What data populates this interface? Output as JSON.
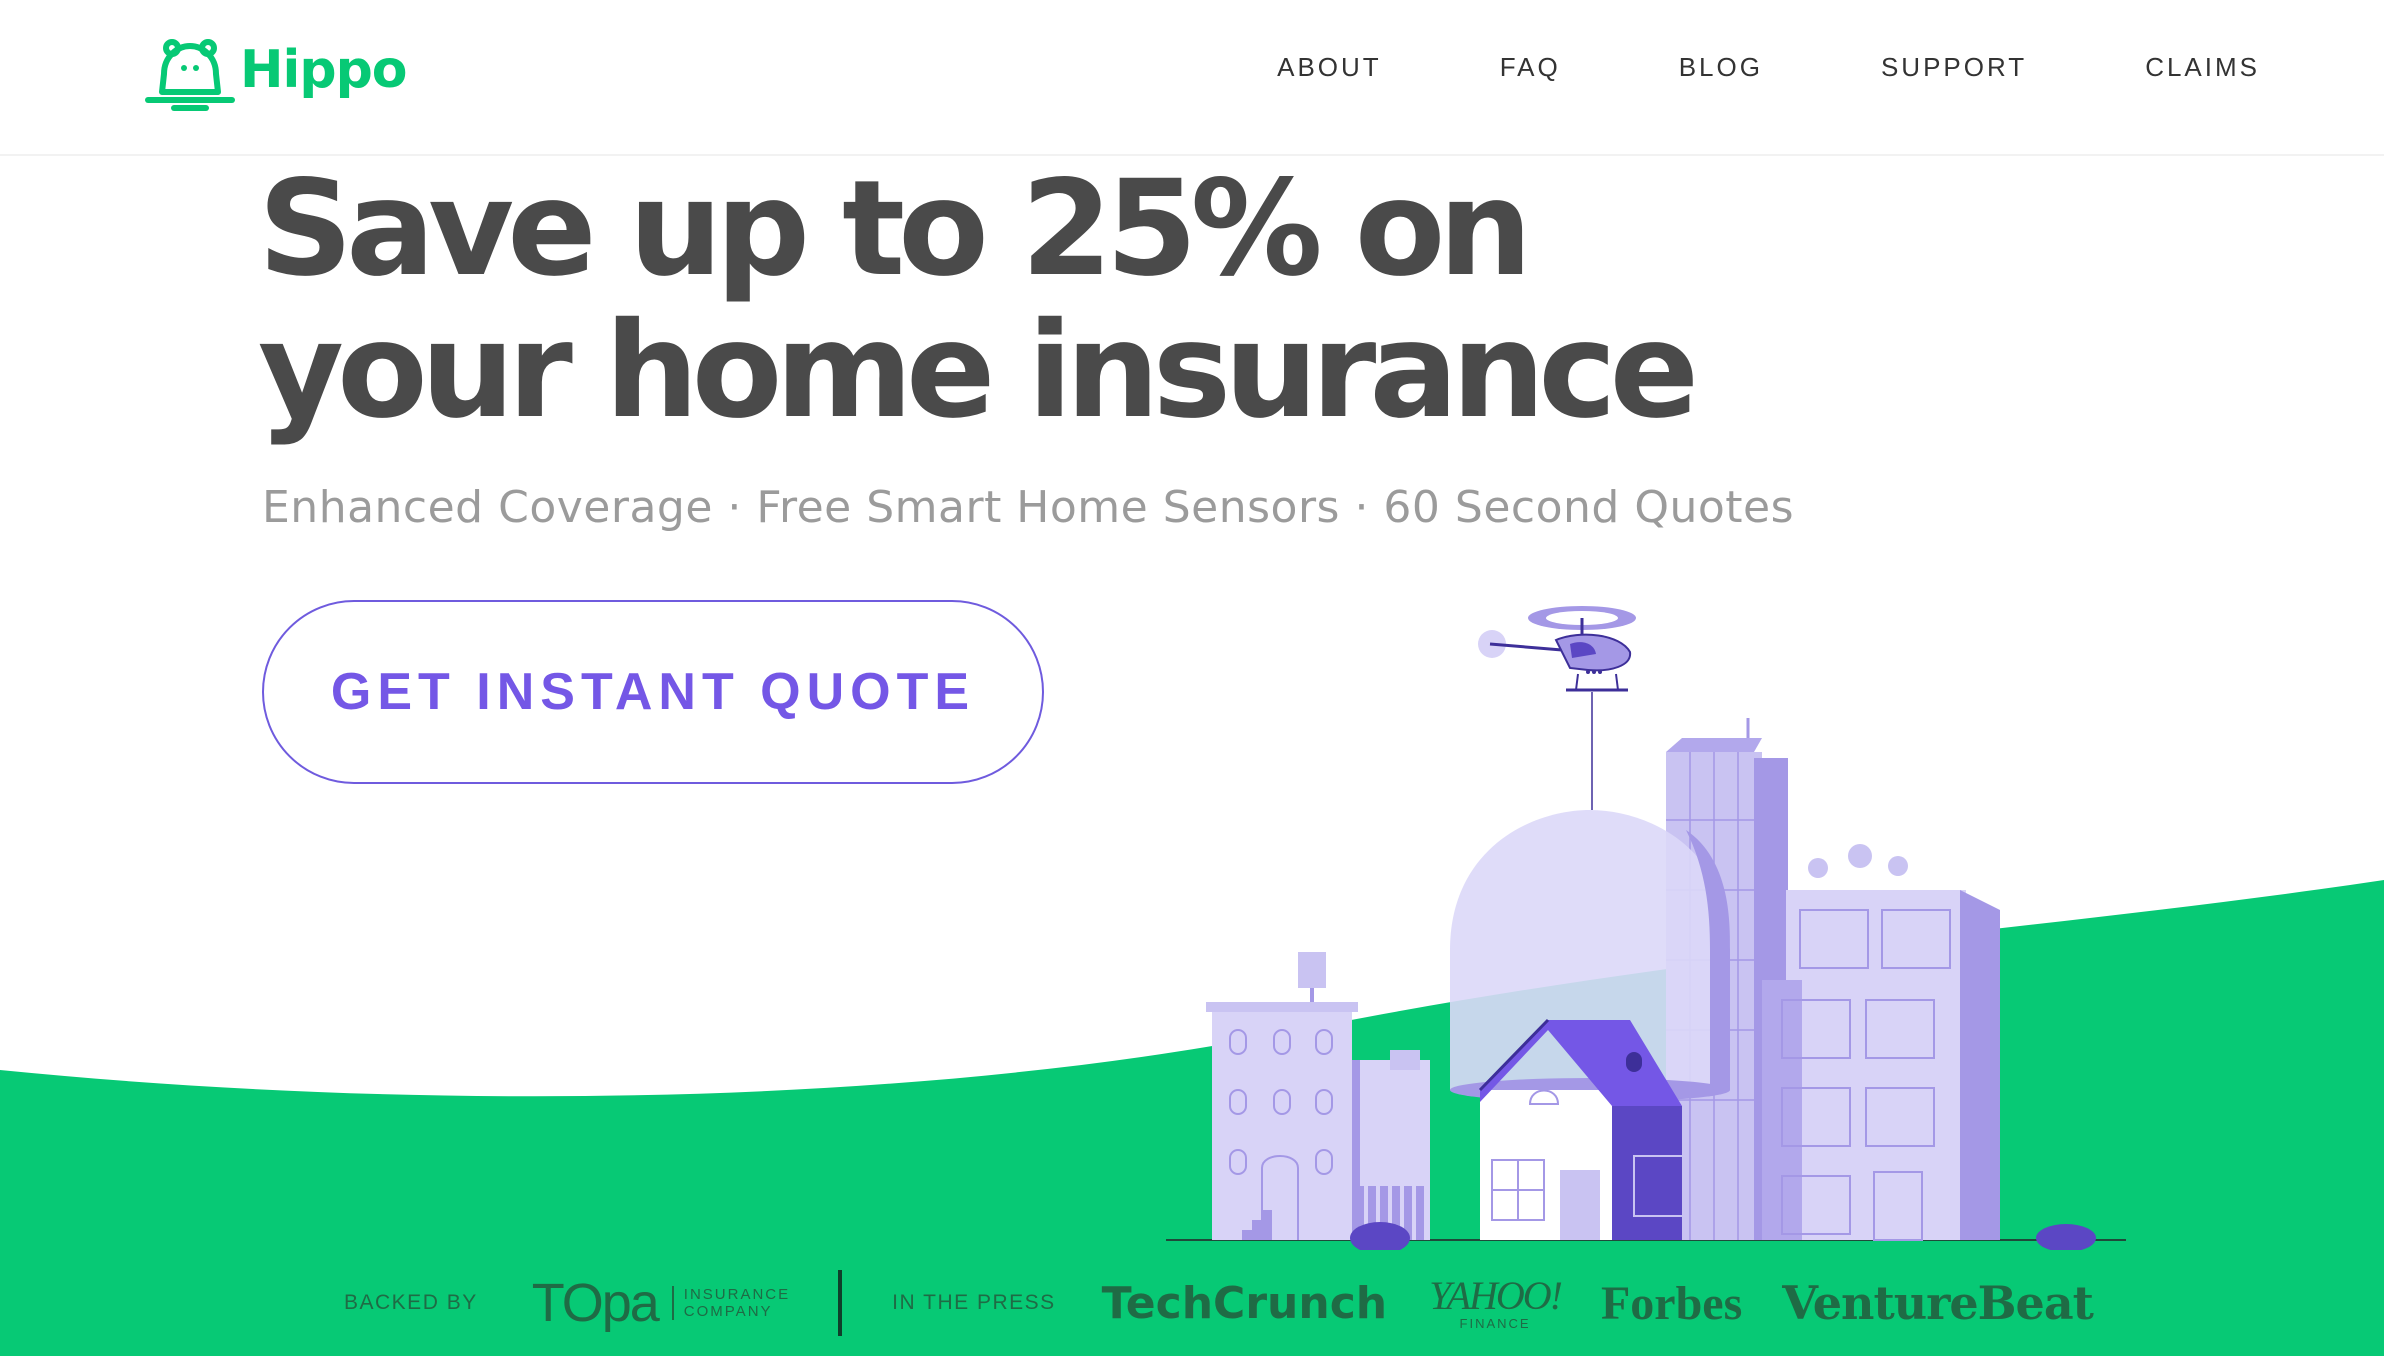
{
  "brand": {
    "name": "Hippo",
    "color": "#07c975"
  },
  "nav": {
    "items": [
      {
        "label": "ABOUT"
      },
      {
        "label": "FAQ"
      },
      {
        "label": "BLOG"
      },
      {
        "label": "SUPPORT"
      },
      {
        "label": "CLAIMS"
      }
    ]
  },
  "hero": {
    "headline_line1": "Save up to 25% on",
    "headline_line2": "your home insurance",
    "subline": "Enhanced Coverage · Free Smart Home Sensors · 60 Second Quotes",
    "cta_label": "GET INSTANT QUOTE",
    "cta_color": "#7457e6"
  },
  "footer_strip": {
    "backed_by_label": "BACKED BY",
    "backer_name": "TOpa",
    "backer_sub_line1": "INSURANCE",
    "backer_sub_line2": "COMPANY",
    "press_label": "IN THE PRESS",
    "press_logos": [
      "TechCrunch",
      "YAHOO!",
      "Forbes",
      "VentureBeat"
    ],
    "yahoo_sub": "FINANCE"
  },
  "colors": {
    "ground": "#07c975",
    "building_light": "#c9c3f2",
    "building_mid": "#a498e6",
    "building_dark": "#5b47c4"
  }
}
